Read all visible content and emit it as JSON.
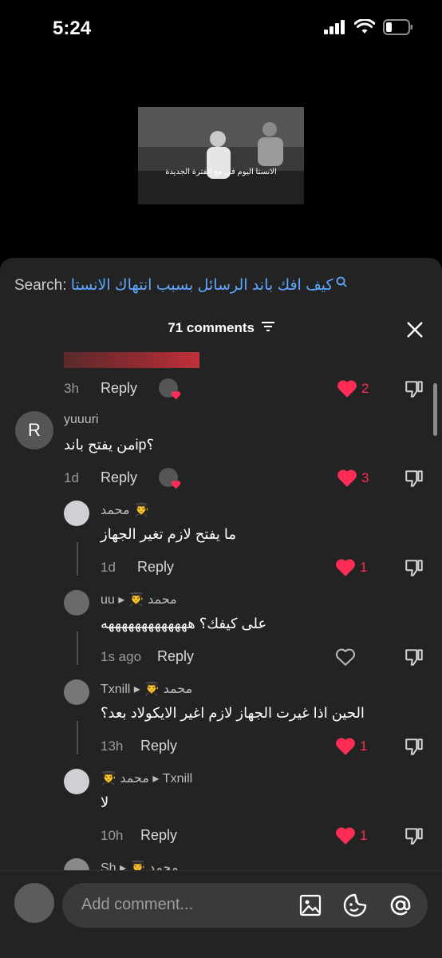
{
  "status_bar": {
    "time": "5:24"
  },
  "video": {
    "caption": "الانستا اليوم في مع الفترة الجديدة"
  },
  "search": {
    "label": "Search:",
    "query": "كيف افك باند الرسائل بسبب انتهاك الانستا"
  },
  "comments": {
    "header": "71 comments",
    "top_partial": {
      "time": "3h",
      "reply": "Reply",
      "likes": "2"
    },
    "items": [
      {
        "avatar_letter": "R",
        "username": "yuuuri",
        "text": "من يفتح باندip؟",
        "time": "1d",
        "reply": "Reply",
        "likes": "3"
      },
      {
        "username": "محمد 👨‍🎓",
        "text": "ما يفتح لازم تغير الجهاز",
        "time": "1d",
        "reply": "Reply",
        "likes": "1"
      },
      {
        "username": "uu ▸ 👨‍🎓 محمد",
        "text": "على كيفك؟ هههههههههههههه",
        "time": "1s ago",
        "reply": "Reply",
        "likes": ""
      },
      {
        "username": "Txnill ▸ 👨‍🎓 محمد",
        "text": "الحين اذا غيرت الجهاز لازم اغير الايكولاد بعد؟",
        "time": "13h",
        "reply": "Reply",
        "likes": "1"
      },
      {
        "username": "👨‍🎓 محمد ▸ Txnill",
        "text": "لا",
        "time": "10h",
        "reply": "Reply",
        "likes": "1"
      },
      {
        "username": "Sh ▸ 👨‍🎓 محمد"
      }
    ]
  },
  "composer": {
    "placeholder": "Add comment..."
  },
  "colors": {
    "accent": "#ff2d55",
    "link": "#5ea6ff",
    "sheet": "#232323"
  }
}
